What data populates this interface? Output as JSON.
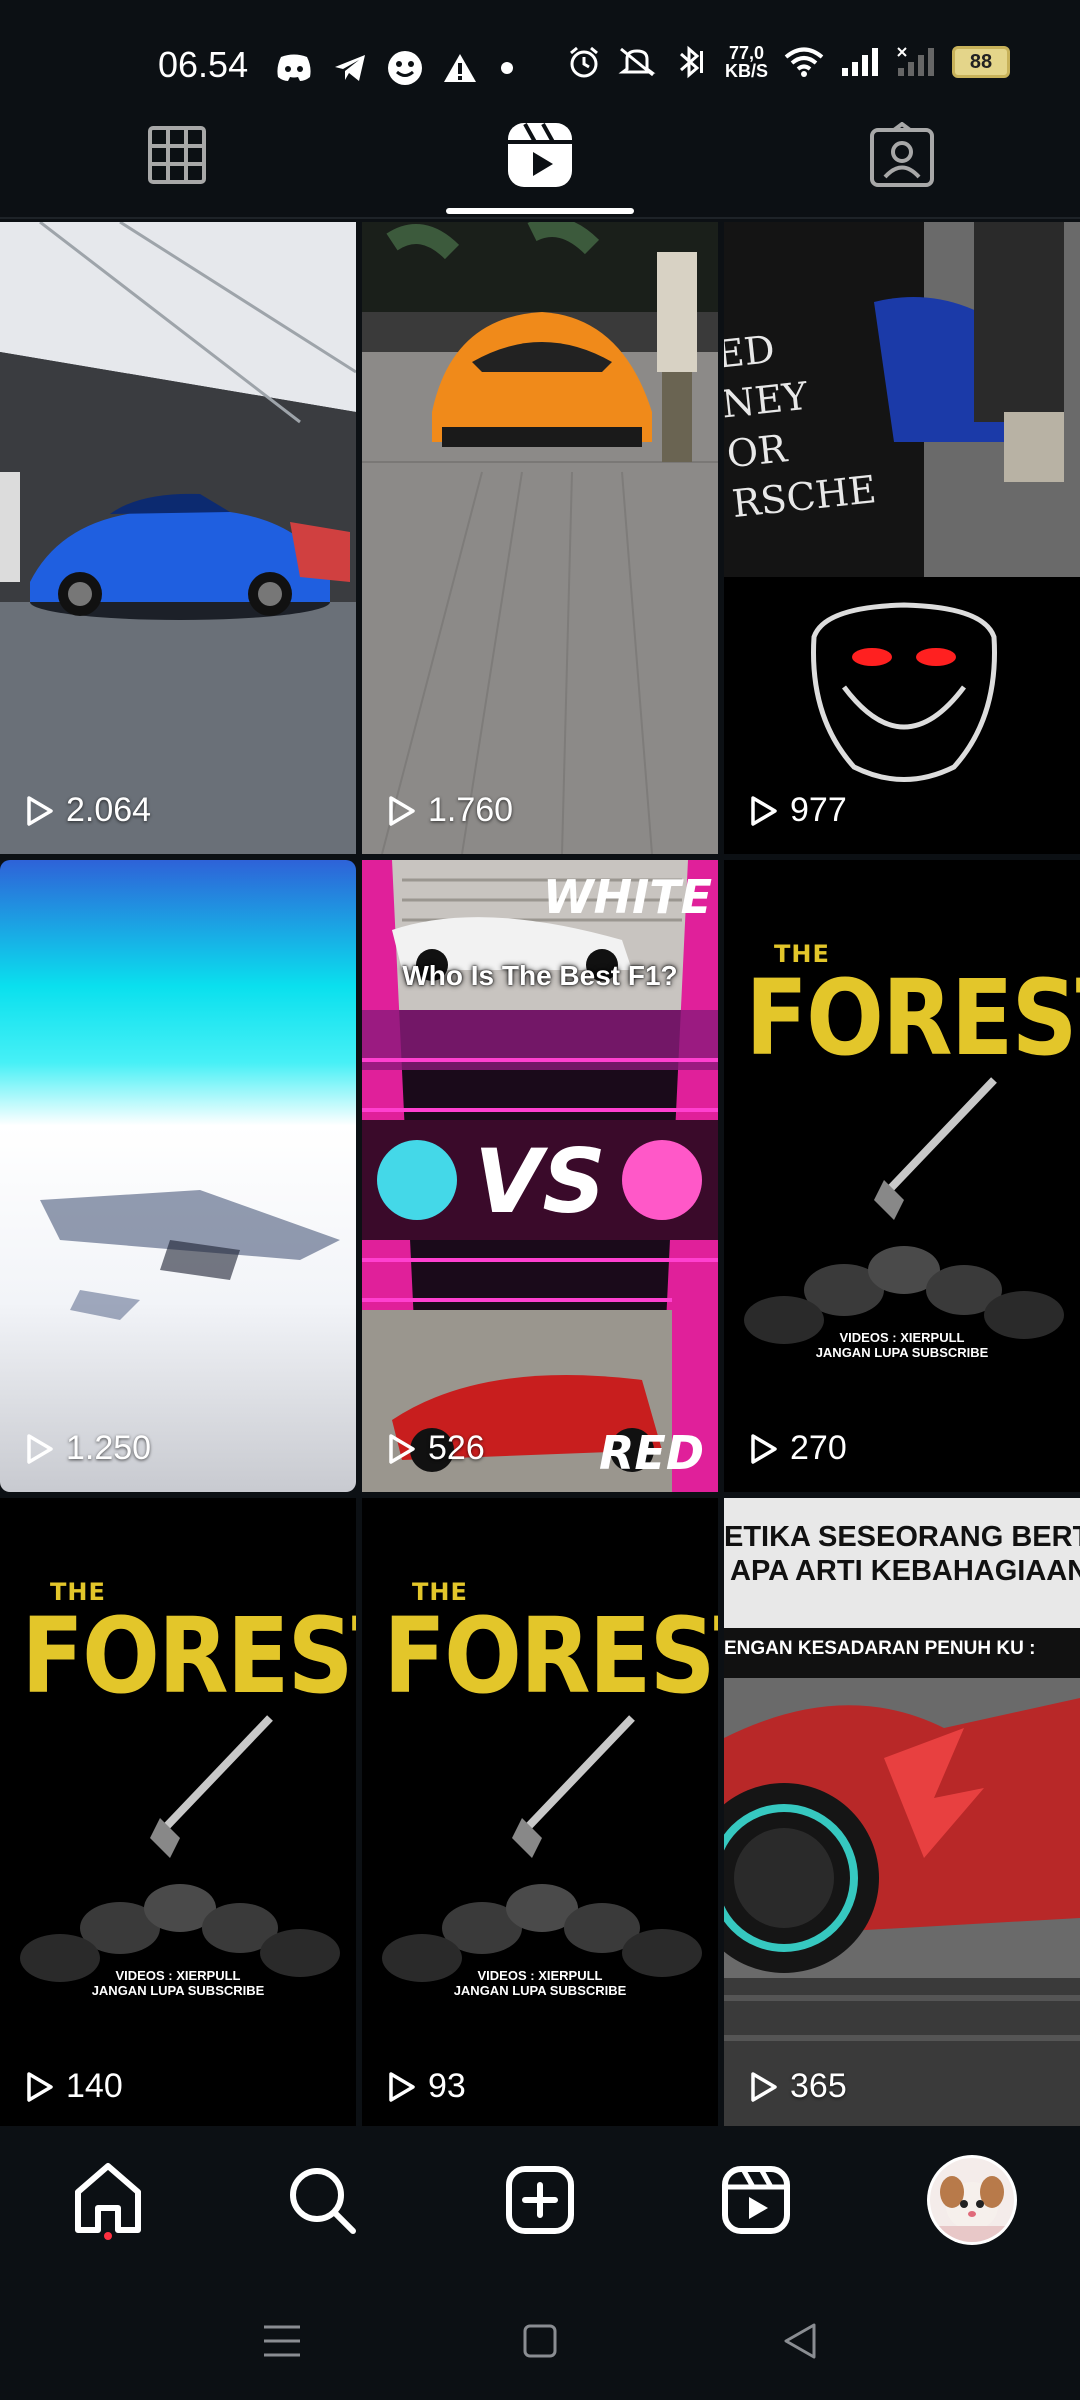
{
  "status_bar": {
    "time": "06.54",
    "network_speed_value": "77,0",
    "network_speed_unit": "KB/S",
    "battery_level": "88"
  },
  "profile_tabs": [
    "grid",
    "reels",
    "tagged"
  ],
  "reels": [
    {
      "views": "2.064"
    },
    {
      "views": "1.760"
    },
    {
      "views": "977",
      "overlay_text": [
        "ED",
        "NEY",
        "OR",
        "RSCHE"
      ]
    },
    {
      "views": "1.250"
    },
    {
      "views": "526",
      "overlay_top": "WHITE",
      "overlay_title": "Who Is The Best F1?",
      "overlay_vs": "VS",
      "overlay_bottom": "RED"
    },
    {
      "views": "270",
      "overlay_the": "THE",
      "overlay_title": "FOREST",
      "overlay_credit_1": "VIDEOS : XIERPULL",
      "overlay_credit_2": "JANGAN LUPA SUBSCRIBE"
    },
    {
      "views": "140",
      "overlay_the": "THE",
      "overlay_title": "FOREST",
      "overlay_credit_1": "VIDEOS : XIERPULL",
      "overlay_credit_2": "JANGAN LUPA SUBSCRIBE"
    },
    {
      "views": "93",
      "overlay_the": "THE",
      "overlay_title": "FOREST",
      "overlay_credit_1": "VIDEOS : XIERPULL",
      "overlay_credit_2": "JANGAN LUPA SUBSCRIBE"
    },
    {
      "views": "365",
      "overlay_line_1": "ETIKA SESEORANG BERTANYA",
      "overlay_line_2": "APA ARTI KEBAHAGIAAN?",
      "overlay_line_3": "ENGAN KESADARAN PENUH KU :"
    }
  ],
  "bottom_nav": [
    "home",
    "search",
    "create",
    "reels",
    "profile"
  ],
  "colors": {
    "background": "#0c1014",
    "forest_yellow": "#e3c62a",
    "notification_dot": "#ff3040"
  }
}
